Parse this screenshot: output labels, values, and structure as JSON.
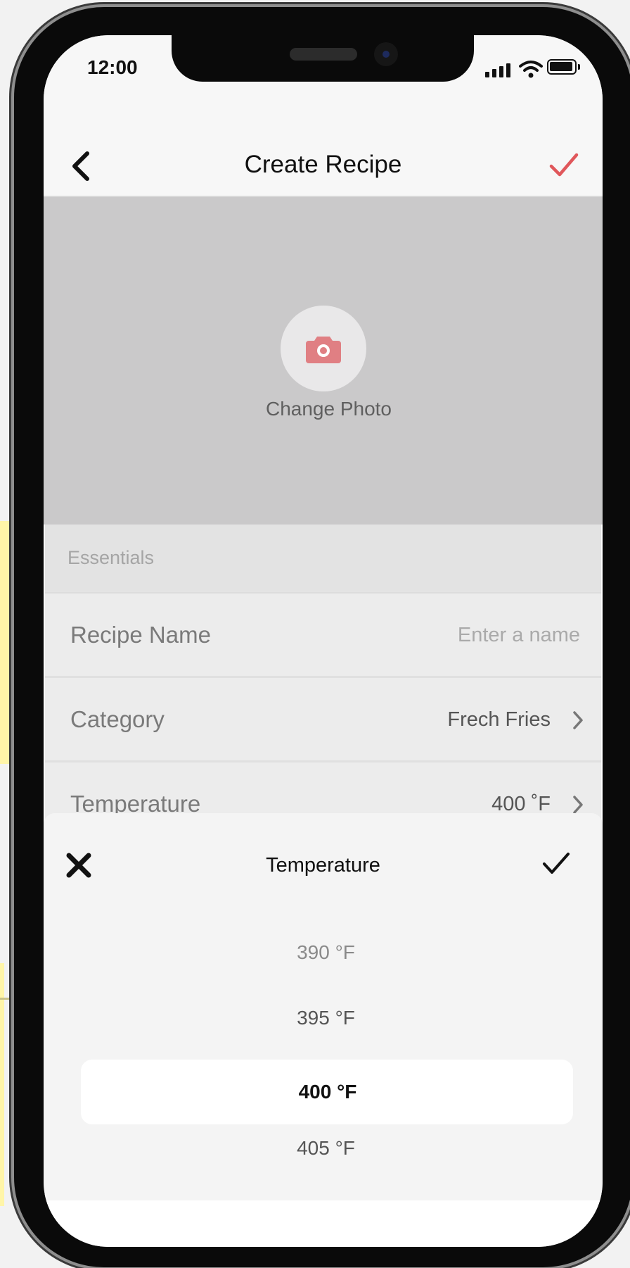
{
  "status_bar": {
    "time": "12:00"
  },
  "nav": {
    "title": "Create Recipe",
    "back_icon": "chevron-left-icon",
    "done_icon": "checkmark-icon",
    "accent": "#e0575b"
  },
  "photo": {
    "label": "Change Photo",
    "icon": "camera-icon",
    "icon_color": "#e07f83"
  },
  "form": {
    "section_title": "Essentials",
    "rows": [
      {
        "label": "Recipe Name",
        "placeholder": "Enter a name"
      },
      {
        "label": "Category",
        "value": "Frech Fries"
      },
      {
        "label": "Temperature",
        "value": "400 ˚F"
      }
    ]
  },
  "picker": {
    "title": "Temperature",
    "options": [
      "390 °F",
      "395 °F",
      "400 °F",
      "405 °F"
    ],
    "selected": "400 °F"
  }
}
